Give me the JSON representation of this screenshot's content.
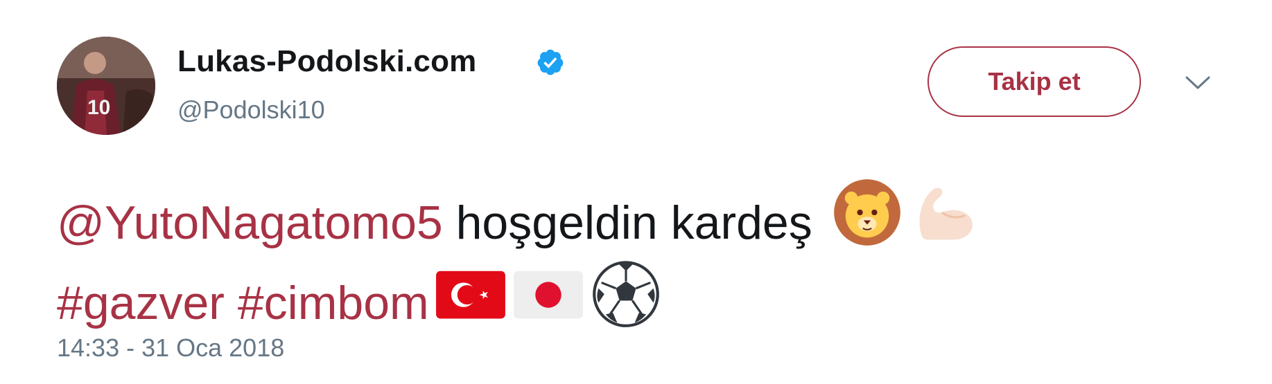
{
  "author": {
    "display_name": "Lukas-Podolski.com",
    "handle": "@Podolski10",
    "verified": true,
    "avatar_icon": "player-avatar"
  },
  "follow_button": {
    "label": "Takip et"
  },
  "tweet": {
    "mention": "@YutoNagatomo5",
    "text": " hoşgeldin kardeş ",
    "hashtag1": "#gazver",
    "hashtag2": "#cimbom",
    "emojis": [
      "lion-face-icon",
      "flexed-biceps-icon",
      "turkey-flag-icon",
      "japan-flag-icon",
      "soccer-ball-icon"
    ],
    "timestamp": "14:33 - 31 Oca 2018"
  },
  "colors": {
    "accent": "#a83245",
    "text": "#14171a",
    "muted": "#657786",
    "verified": "#1da1f2"
  }
}
